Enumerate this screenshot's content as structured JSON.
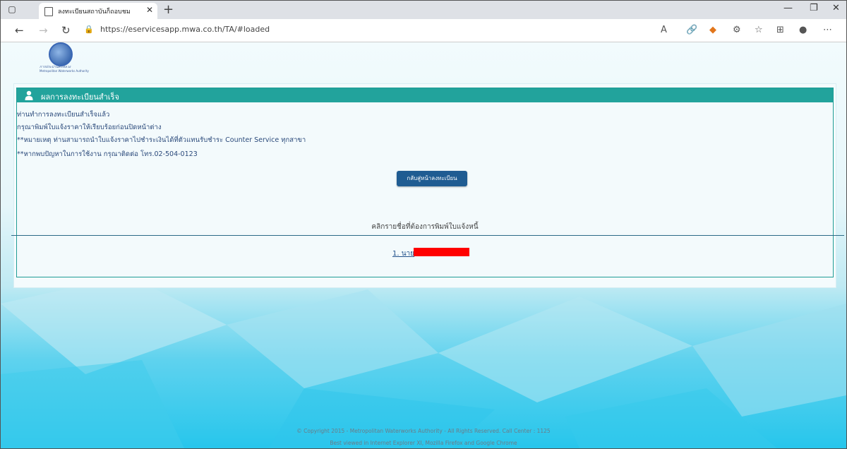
{
  "browser": {
    "tab_title": "ลงทะเบียนสถาบันก็ถอบชม",
    "url": "https://eservicesapp.mwa.co.th/TA/#loaded"
  },
  "logo": {
    "line1": "การประปานครหลวง",
    "line2": "Metropolitan Waterworks Authority"
  },
  "panel": {
    "title": "ผลการลงทะเบียนสำเร็จ",
    "lines": [
      "ท่านทำการลงทะเบียนสำเร็จแล้ว",
      "กรุณาพิมพ์ใบแจ้งราคาให้เรียบร้อยก่อนปิดหน้าต่าง",
      "**หมายเหตุ ท่านสามารถนำใบแจ้งราคาไปชำระเงินได้ที่ตัวแทนรับชำระ Counter Service ทุกสาขา",
      "**หากพบปัญหาในการใช้งาน กรุณาติดต่อ โทร.02-504-0123"
    ],
    "back_button": "กลับสู่หน้าลงทะเบียน",
    "hint": "คลิกรายชื่อที่ต้องการพิมพ์ใบแจ้งหนี้",
    "name_link": "1. นาย"
  },
  "footer": {
    "line1": "© Copyright 2015 - Metropolitan Waterworks Authority - All Rights Reserved. Call Center : 1125",
    "line2": "Best viewed in Internet Explorer XI, Mozilla Firefox and Google Chrome"
  },
  "colors": {
    "panel_header": "#22a39c",
    "button": "#1f5c92",
    "redaction": "#ff0000"
  }
}
